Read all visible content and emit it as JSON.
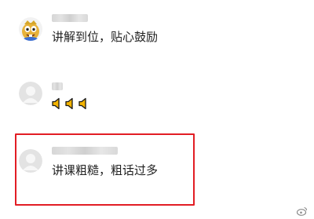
{
  "comments": [
    {
      "username": "",
      "avatar": "cartoon-yellow-avatar",
      "text": "讲解到位，贴心鼓励",
      "emoji": []
    },
    {
      "username": "",
      "avatar": "default-gray-avatar",
      "text": "",
      "emoji": [
        "speaker-icon",
        "speaker-icon",
        "speaker-icon"
      ]
    },
    {
      "username": "",
      "avatar": "default-gray-avatar",
      "text": "讲课粗糙，粗话过多",
      "emoji": []
    }
  ],
  "highlight": {
    "color": "#e21d24"
  },
  "watermark": {
    "icon": "weibo-logo-icon",
    "text": ""
  },
  "colors": {
    "background": "#ffffff",
    "text": "#222222",
    "placeholder_avatar": "#e3e3e3",
    "emoji_yellow": "#f4b400"
  }
}
